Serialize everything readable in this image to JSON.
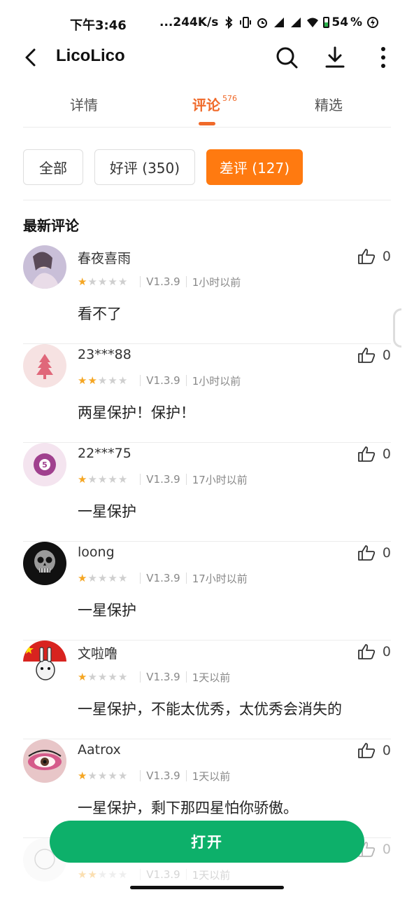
{
  "status_bar": {
    "time": "下午3:46",
    "net_speed": "...244K/s",
    "battery": "54",
    "battery_suffix": "%"
  },
  "header": {
    "app_name": "LicoLico"
  },
  "tabs": [
    {
      "label": "详情"
    },
    {
      "label": "评论",
      "count": "576"
    },
    {
      "label": "精选"
    }
  ],
  "filters": [
    {
      "label": "全部"
    },
    {
      "label": "好评 (350)"
    },
    {
      "label": "差评 (127)"
    }
  ],
  "section_title": "最新评论",
  "comments": [
    {
      "user": "春夜喜雨",
      "rating": 1,
      "version": "V1.3.9",
      "time": "1小时以前",
      "text": "看不了",
      "likes": "0",
      "avatar": "photo-girl-avatar"
    },
    {
      "user": "23***88",
      "rating": 2,
      "version": "V1.3.9",
      "time": "1小时以前",
      "text": "两星保护！保护！",
      "likes": "0",
      "avatar": "pink-tree-avatar"
    },
    {
      "user": "22***75",
      "rating": 1,
      "version": "V1.3.9",
      "time": "17小时以前",
      "text": "一星保护",
      "likes": "0",
      "avatar": "purple-ball-avatar"
    },
    {
      "user": "loong",
      "rating": 1,
      "version": "V1.3.9",
      "time": "17小时以前",
      "text": "一星保护",
      "likes": "0",
      "avatar": "skull-avatar"
    },
    {
      "user": "文啦噜",
      "rating": 1,
      "version": "V1.3.9",
      "time": "1天以前",
      "text": "一星保护，不能太优秀，太优秀会消失的",
      "likes": "0",
      "avatar": "rabbit-flag-avatar"
    },
    {
      "user": "Aatrox",
      "rating": 1,
      "version": "V1.3.9",
      "time": "1天以前",
      "text": "一星保护，剩下那四星怕你骄傲。",
      "likes": "0",
      "avatar": "eye-makeup-avatar"
    },
    {
      "user": "",
      "rating": 2,
      "version": "V1.3.9",
      "time": "1天以前",
      "text": "",
      "likes": "0",
      "avatar": "partial-avatar"
    }
  ],
  "open_button": "打开",
  "colors": {
    "accent": "#f06a2a",
    "filter_active": "#ff7a10",
    "open_button": "#0db06a",
    "star": "#f5a623"
  }
}
